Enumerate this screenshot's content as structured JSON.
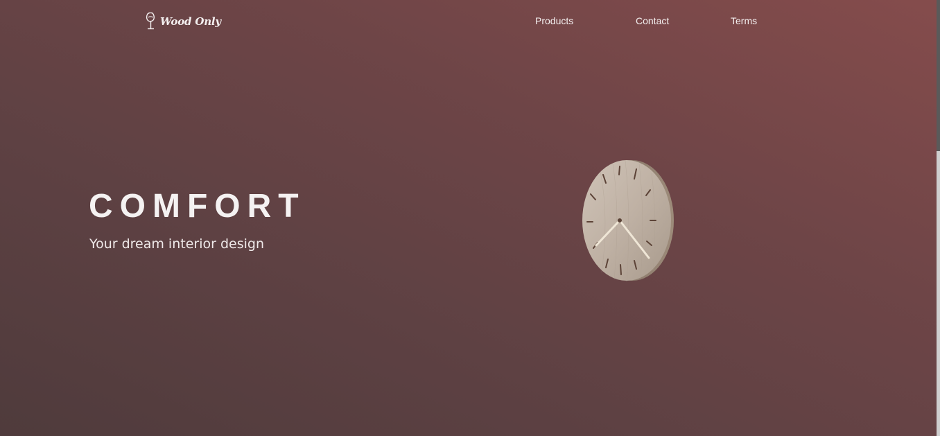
{
  "header": {
    "brand": "Wood Only",
    "logo_icon": "wine-glass-icon",
    "nav": [
      {
        "label": "Products"
      },
      {
        "label": "Contact"
      },
      {
        "label": "Terms"
      }
    ]
  },
  "hero": {
    "title": "COMFORT",
    "subtitle": "Your dream interior design",
    "image": "wooden-wall-clock"
  },
  "colors": {
    "gradient_dark": "#4f3b3c",
    "gradient_light": "#854c4c",
    "text": "#f2eeee"
  },
  "scrollbar": {
    "position_fraction": 0
  }
}
